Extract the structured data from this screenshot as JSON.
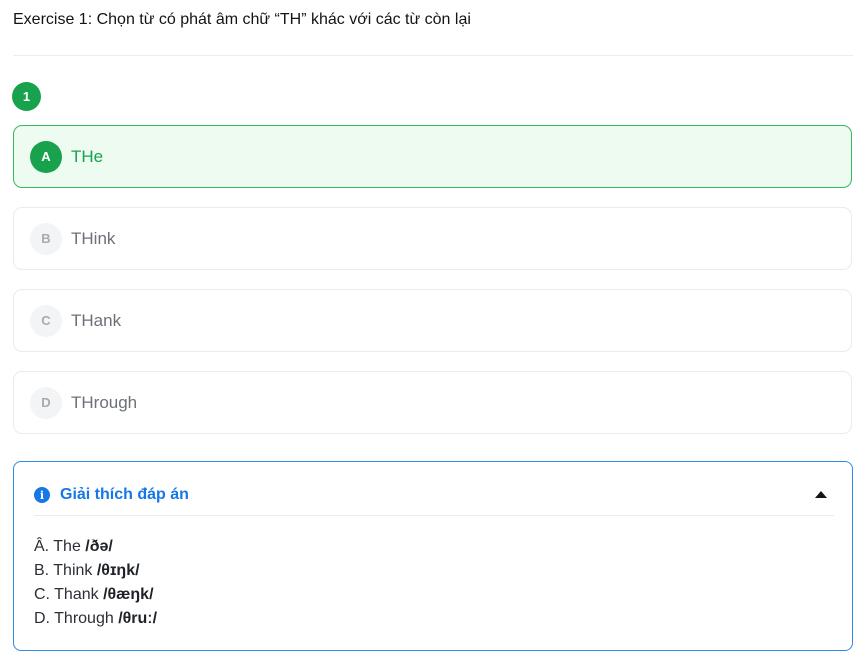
{
  "exercise": {
    "title": "Exercise 1: Chọn từ có phát âm chữ “TH” khác với các từ còn lại"
  },
  "question": {
    "number": "1",
    "options": [
      {
        "letter": "A",
        "text": "THe",
        "state": "correct"
      },
      {
        "letter": "B",
        "text": "THink",
        "state": "default"
      },
      {
        "letter": "C",
        "text": "THank",
        "state": "default"
      },
      {
        "letter": "D",
        "text": "THrough",
        "state": "default"
      }
    ]
  },
  "explanation": {
    "icon": "info-icon",
    "toggle_icon": "caret-up-icon",
    "title": "Giải thích đáp án",
    "lines": [
      {
        "prefix": "Â. The ",
        "ipa": "/ðə/"
      },
      {
        "prefix": "B. Think ",
        "ipa": "/θɪŋk/"
      },
      {
        "prefix": "C. Thank ",
        "ipa": "/θæŋk/"
      },
      {
        "prefix": "D. Through ",
        "ipa": "/θruː/"
      }
    ]
  },
  "colors": {
    "correct_green": "#19a24d",
    "correct_bg": "#eefbf1",
    "info_blue": "#1677e6",
    "panel_border": "#2f8ae8"
  }
}
